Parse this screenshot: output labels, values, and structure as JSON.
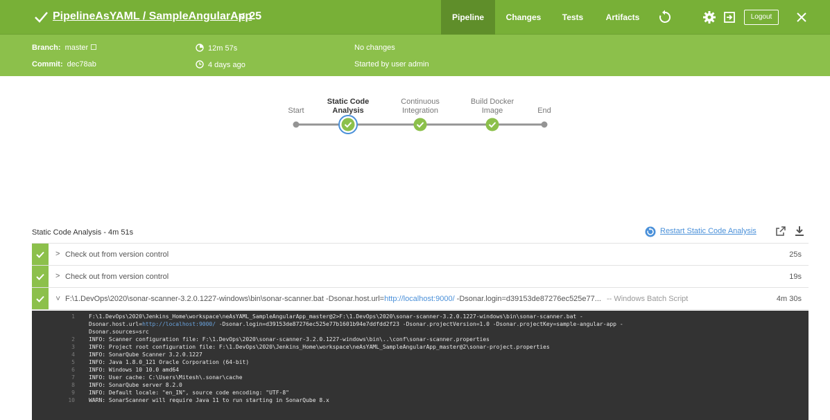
{
  "header": {
    "title": "PipelineAsYAML / SampleAngularApp",
    "run_number": "25",
    "back_arrow": "<",
    "tabs": [
      {
        "label": "Pipeline",
        "active": true
      },
      {
        "label": "Changes",
        "active": false
      },
      {
        "label": "Tests",
        "active": false
      },
      {
        "label": "Artifacts",
        "active": false
      }
    ],
    "logout_label": "Logout",
    "colors": {
      "bar": "#78b037",
      "tab_active": "#5f8e2a"
    }
  },
  "info": {
    "branch_label": "Branch:",
    "branch_value": "master",
    "commit_label": "Commit:",
    "commit_value": "dec78ab",
    "duration": "12m 57s",
    "time_ago": "4 days ago",
    "changes": "No changes",
    "started_by": "Started by user admin",
    "color": "#8cc04b"
  },
  "pipeline": {
    "stages": [
      {
        "label": "Start",
        "state": "node"
      },
      {
        "label": "Static Code Analysis",
        "state": "success",
        "selected": true
      },
      {
        "label": "Continuous Integration",
        "state": "success"
      },
      {
        "label": "Build Docker Image",
        "state": "success"
      },
      {
        "label": "End",
        "state": "node"
      }
    ],
    "success_color": "#8cc04b",
    "selected_ring_color": "#4a90d9"
  },
  "stage_detail": {
    "title": "Static Code Analysis - 4m 51s",
    "restart_label": "Restart Static Code Analysis",
    "steps": [
      {
        "label": "Check out from version control",
        "duration": "25s",
        "expanded": false
      },
      {
        "label": "Check out from version control",
        "duration": "19s",
        "expanded": false
      },
      {
        "label_prefix": "F:\\1.DevOps\\2020\\sonar-scanner-3.2.0.1227-windows\\bin\\sonar-scanner.bat -Dsonar.host.url=",
        "label_url": "http://localhost:9000/",
        "label_suffix": " -Dsonar.login=d39153de87276ec525e77...",
        "kind": "-- Windows Batch Script",
        "duration": "4m 30s",
        "expanded": true
      }
    ]
  },
  "console": {
    "lines": [
      {
        "n": "1",
        "pre": "F:\\1.DevOps\\2020\\Jenkins_Home\\workspace\\neAsYAML_SampleAngularApp_master@2>F:\\1.DevOps\\2020\\sonar-scanner-3.2.0.1227-windows\\bin\\sonar-scanner.bat -",
        "url": "",
        "post": ""
      },
      {
        "n": "",
        "pre": "Dsonar.host.url=",
        "url": "http://localhost:9000/",
        "post": " -Dsonar.login=d39153de87276ec525e77b1601b94e7ddfdd2f23 -Dsonar.projectVersion=1.0 -Dsonar.projectKey=sample-angular-app -"
      },
      {
        "n": "",
        "pre": "Dsonar.sources=src",
        "url": "",
        "post": ""
      },
      {
        "n": "2",
        "pre": "INFO: Scanner configuration file: F:\\1.DevOps\\2020\\sonar-scanner-3.2.0.1227-windows\\bin\\..\\conf\\sonar-scanner.properties",
        "url": "",
        "post": ""
      },
      {
        "n": "3",
        "pre": "INFO: Project root configuration file: F:\\1.DevOps\\2020\\Jenkins_Home\\workspace\\neAsYAML_SampleAngularApp_master@2\\sonar-project.properties",
        "url": "",
        "post": ""
      },
      {
        "n": "4",
        "pre": "INFO: SonarQube Scanner 3.2.0.1227",
        "url": "",
        "post": ""
      },
      {
        "n": "5",
        "pre": "INFO: Java 1.8.0_121 Oracle Corporation (64-bit)",
        "url": "",
        "post": ""
      },
      {
        "n": "6",
        "pre": "INFO: Windows 10 10.0 amd64",
        "url": "",
        "post": ""
      },
      {
        "n": "7",
        "pre": "INFO: User cache: C:\\Users\\Mitesh\\.sonar\\cache",
        "url": "",
        "post": ""
      },
      {
        "n": "8",
        "pre": "INFO: SonarQube server 8.2.0",
        "url": "",
        "post": ""
      },
      {
        "n": "9",
        "pre": "INFO: Default locale: \"en_IN\", source code encoding: \"UTF-8\"",
        "url": "",
        "post": ""
      },
      {
        "n": "10",
        "pre": "WARN: SonarScanner will require Java 11 to run starting in SonarQube 8.x",
        "url": "",
        "post": ""
      }
    ]
  }
}
